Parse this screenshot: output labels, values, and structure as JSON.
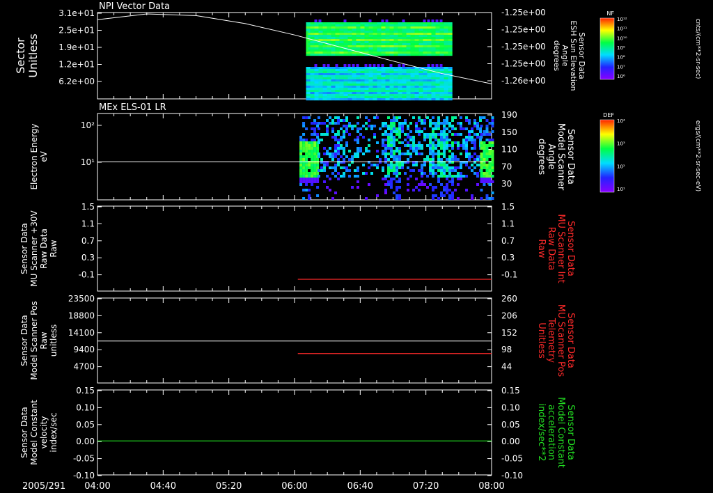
{
  "colors": {
    "background": "#000000",
    "axis": "#ffffff",
    "red_trace": "#ff2a2a",
    "green_trace": "#22dd22"
  },
  "footer": {
    "date_label": "2005/291"
  },
  "time_axis": {
    "range": [
      "04:00",
      "08:00"
    ],
    "tick_labels": [
      "04:00",
      "04:40",
      "05:20",
      "06:00",
      "06:40",
      "07:20",
      "08:00"
    ]
  },
  "panels": [
    {
      "id": "p1",
      "title": "NPI Vector Data",
      "left_label": [
        "Sector",
        "Unitless"
      ],
      "right_label": [
        "Sensor Data",
        "ESH Sun Elevation",
        "Angle",
        "degrees"
      ],
      "left_ticks": [
        "3.1e+01",
        "2.5e+01",
        "1.9e+01",
        "1.2e+01",
        "6.2e+00"
      ],
      "right_ticks": [
        "-1.25e+00",
        "-1.25e+00",
        "-1.25e+00",
        "-1.25e+00",
        "-1.26e+00"
      ],
      "colorbar": {
        "label": "NF",
        "unit": "cnts/(cm**2-sr-sec)",
        "ticks": [
          "10¹²",
          "10¹¹",
          "10¹⁰",
          "10⁹",
          "10⁸",
          "10⁷",
          "10⁶"
        ]
      }
    },
    {
      "id": "p2",
      "title": "MEx ELS-01 LR",
      "left_label": [
        "Electron Energy",
        "eV"
      ],
      "right_label": [
        "Sensor Data",
        "Model Scanner",
        "Angle",
        "degrees"
      ],
      "left_ticks": [
        "10²",
        "10¹"
      ],
      "right_ticks": [
        "190",
        "150",
        "110",
        "70",
        "30"
      ],
      "colorbar": {
        "label": "DEF",
        "unit": "ergs/(cm**2-sr-sec-eV)",
        "ticks": [
          "10⁴",
          "10³",
          "10²",
          "10¹"
        ]
      }
    },
    {
      "id": "p3",
      "title": "",
      "left_label": [
        "Sensor Data",
        "MU Scanner +30V",
        "Raw Data",
        "Raw"
      ],
      "right_label": [
        "Sensor Data",
        "MU Scanner Int",
        "Raw Data",
        "Raw"
      ],
      "left_ticks": [
        "1.5",
        "1.1",
        "0.7",
        "0.3",
        "-0.1"
      ],
      "right_ticks": [
        "1.5",
        "1.1",
        "0.7",
        "0.3",
        "-0.1"
      ]
    },
    {
      "id": "p4",
      "title": "",
      "left_label": [
        "Sensor Data",
        "Model Scanner Pos",
        "Raw",
        "unitless"
      ],
      "right_label": [
        "Sensor Data",
        "MU Scanner Pos",
        "Telemetry",
        "Unitless"
      ],
      "left_ticks": [
        "23500",
        "18800",
        "14100",
        "9400",
        "4700"
      ],
      "right_ticks": [
        "260",
        "206",
        "152",
        "98",
        "44"
      ]
    },
    {
      "id": "p5",
      "title": "",
      "left_label": [
        "Sensor Data",
        "Model Constant",
        "velocity",
        "index/sec"
      ],
      "right_label": [
        "Sensor Data",
        "Model Constant",
        "acceleration",
        "index/sec**2"
      ],
      "left_ticks": [
        "0.15",
        "0.10",
        "0.05",
        "0.00",
        "-0.05",
        "-0.10"
      ],
      "right_ticks": [
        "0.15",
        "0.10",
        "0.05",
        "0.00",
        "-0.05",
        "-0.10"
      ]
    }
  ],
  "chart_data": [
    {
      "type": "heatmap",
      "title": "NPI Vector Data",
      "xlabel": "",
      "ylabel": "Sector Unitless",
      "xlim": [
        "04:00",
        "08:00"
      ],
      "ylim": [
        0,
        31
      ],
      "spectrogram_time_span": [
        "06:07",
        "07:35"
      ],
      "series": [
        {
          "name": "Sensor Data ESH Sun Elevation Angle",
          "axis": "right",
          "x": [
            "04:00",
            "04:30",
            "05:00",
            "05:30",
            "06:00",
            "06:30",
            "07:00",
            "07:30",
            "08:00"
          ],
          "y": [
            -1.2485,
            -1.2475,
            -1.2478,
            -1.2492,
            -1.2512,
            -1.2535,
            -1.2558,
            -1.258,
            -1.2598
          ]
        }
      ]
    },
    {
      "type": "heatmap",
      "title": "MEx ELS-01 LR",
      "xlabel": "",
      "ylabel": "Electron Energy eV",
      "xlim": [
        "04:00",
        "08:00"
      ],
      "yscale": "log",
      "ylim": [
        1,
        200
      ],
      "data_spans": [
        [
          "06:03",
          "06:14"
        ],
        [
          "06:14",
          "07:53"
        ],
        [
          "07:53",
          "08:00"
        ]
      ],
      "series": [
        {
          "name": "Sensor Data Model Scanner Angle",
          "axis": "right",
          "x": [
            "04:00",
            "08:00"
          ],
          "y": [
            90,
            90
          ]
        }
      ]
    },
    {
      "type": "line",
      "ylabel": "Sensor Data MU Scanner +30V Raw Data Raw",
      "xlim": [
        "04:00",
        "08:00"
      ],
      "ylim": [
        -0.3,
        1.5
      ],
      "series": [
        {
          "name": "Sensor Data MU Scanner Int Raw Data Raw",
          "axis": "right",
          "x": [
            "06:02",
            "08:00"
          ],
          "y": [
            -0.05,
            -0.05
          ]
        }
      ]
    },
    {
      "type": "line",
      "ylabel": "Sensor Data Model Scanner Pos Raw unitless",
      "xlim": [
        "04:00",
        "08:00"
      ],
      "ylim": [
        0,
        23500
      ],
      "series": [
        {
          "name": "Sensor Data Model Scanner Pos Raw unitless",
          "axis": "left",
          "x": [
            "04:00",
            "08:00"
          ],
          "y": [
            11600,
            11600
          ]
        },
        {
          "name": "Sensor Data MU Scanner Pos Telemetry Unitless",
          "axis": "right",
          "x": [
            "06:02",
            "08:00"
          ],
          "y": [
            90,
            90
          ]
        }
      ]
    },
    {
      "type": "line",
      "ylabel": "Sensor Data Model Constant velocity index/sec",
      "xlim": [
        "04:00",
        "08:00"
      ],
      "ylim": [
        -0.1,
        0.15
      ],
      "series": [
        {
          "name": "Sensor Data Model Constant acceleration index/sec**2",
          "axis": "right",
          "x": [
            "04:00",
            "08:00"
          ],
          "y": [
            0.0,
            0.0
          ]
        }
      ]
    }
  ]
}
